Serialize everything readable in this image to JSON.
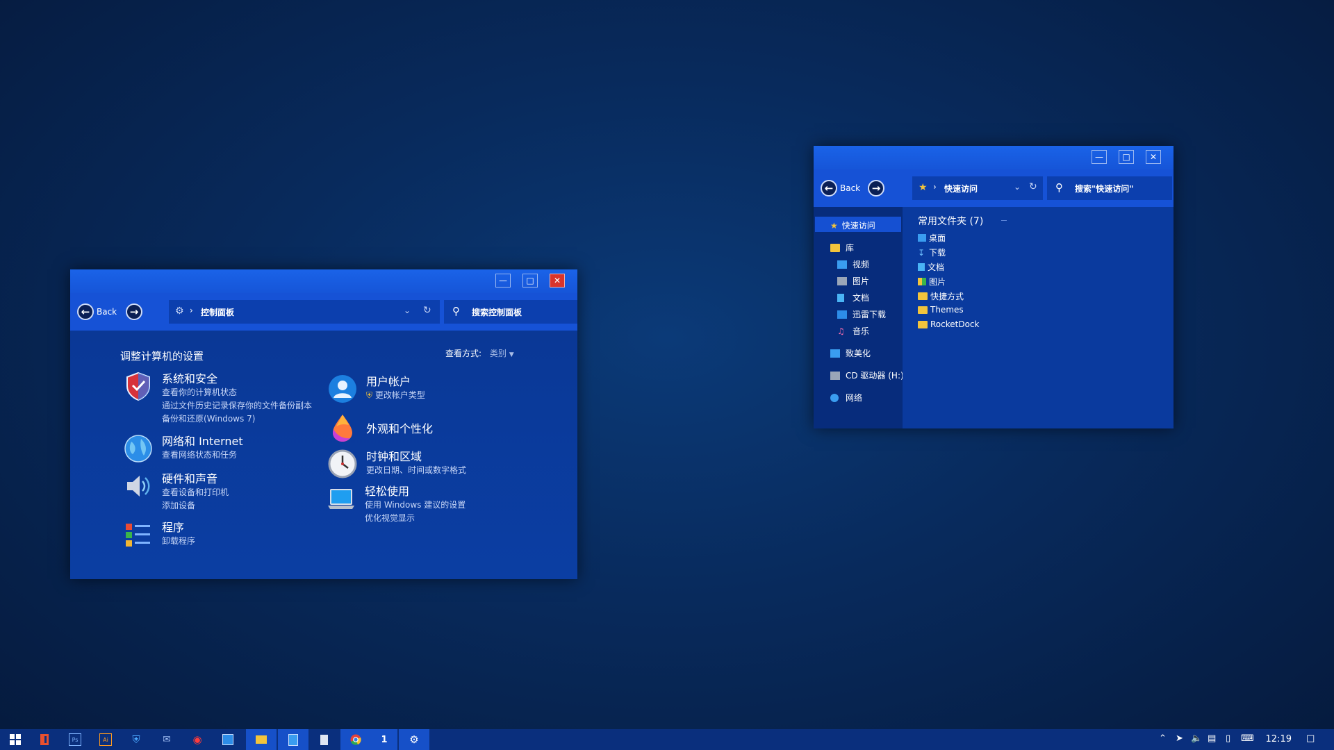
{
  "control_panel": {
    "back_label": "Back",
    "address": "控制面板",
    "search_placeholder": "搜索控制面板",
    "heading": "调整计算机的设置",
    "view_by_label": "查看方式:",
    "view_by_value": "类别",
    "categories_left": [
      {
        "title": "系统和安全",
        "subs": [
          "查看你的计算机状态",
          "通过文件历史记录保存你的文件备份副本",
          "备份和还原(Windows 7)"
        ],
        "icon": "shield-icon"
      },
      {
        "title": "网络和 Internet",
        "subs": [
          "查看网络状态和任务"
        ],
        "icon": "globe-icon"
      },
      {
        "title": "硬件和声音",
        "subs": [
          "查看设备和打印机",
          "添加设备"
        ],
        "icon": "speaker-icon"
      },
      {
        "title": "程序",
        "subs": [
          "卸载程序"
        ],
        "icon": "programs-icon"
      }
    ],
    "categories_right": [
      {
        "title": "用户帐户",
        "subs": [
          "更改帐户类型"
        ],
        "icon": "user-icon"
      },
      {
        "title": "外观和个性化",
        "subs": [],
        "icon": "paint-drop-icon"
      },
      {
        "title": "时钟和区域",
        "subs": [
          "更改日期、时间或数字格式"
        ],
        "icon": "clock-icon"
      },
      {
        "title": "轻松使用",
        "subs": [
          "使用 Windows 建议的设置",
          "优化视觉显示"
        ],
        "icon": "laptop-icon"
      }
    ]
  },
  "explorer": {
    "back_label": "Back",
    "address": "快速访问",
    "search_placeholder": "搜索\"快速访问\"",
    "nav": {
      "quick_access": "快速访问",
      "library": "库",
      "library_items": [
        "视频",
        "图片",
        "文档",
        "迅雷下载",
        "音乐"
      ],
      "personalize": "致美化",
      "cd_drive": "CD 驱动器 (H:)",
      "network": "网络"
    },
    "section_title": "常用文件夹 (7)",
    "folders": [
      "桌面",
      "下载",
      "文档",
      "图片",
      "快捷方式",
      "Themes",
      "RocketDock"
    ]
  },
  "taskbar": {
    "pinned": [
      "start-icon",
      "office-icon",
      "photoshop-icon",
      "illustrator-icon",
      "security-icon",
      "mail-icon",
      "netease-music-icon",
      "photos-icon",
      "file-explorer-icon",
      "notepad-icon",
      "calculator-icon",
      "chrome-icon",
      "badge-icon",
      "settings-icon"
    ],
    "ai_label": "Ai",
    "ps_label": "Ps",
    "badge_label": "1",
    "clock": "12:19"
  },
  "colors": {
    "desktop": "#082a5c",
    "window_body": "#0a3a9a",
    "titlebar": "#1655d8",
    "close": "#d9342b",
    "folder": "#f2c43c"
  }
}
